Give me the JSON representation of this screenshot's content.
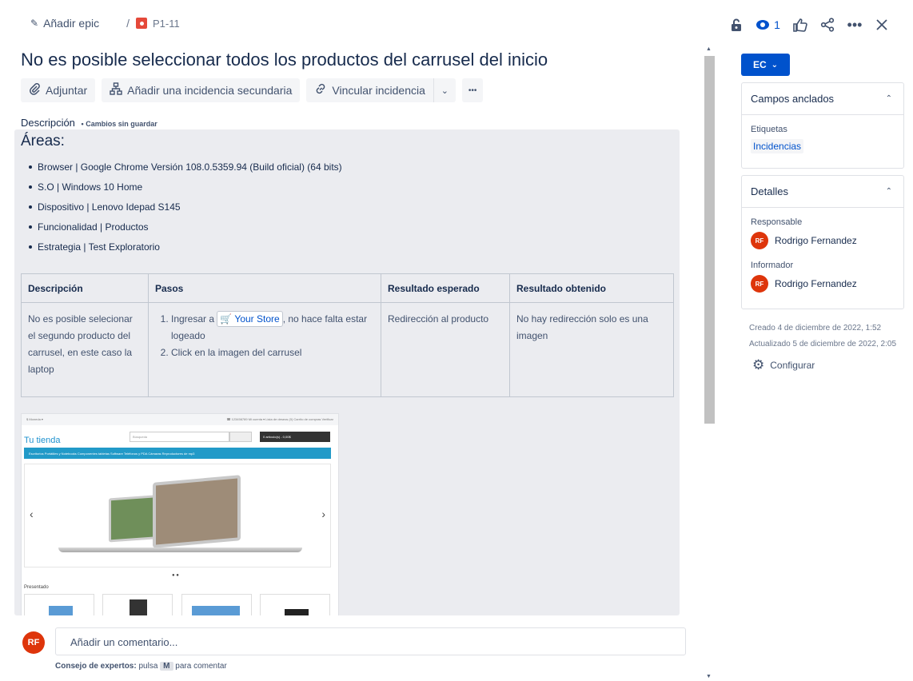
{
  "breadcrumb": {
    "add_epic": "Añadir epic",
    "separator": "/",
    "issue_key": "P1-11"
  },
  "header": {
    "watchers": "1"
  },
  "issue": {
    "title": "No es posible seleccionar todos los productos del carrusel del inicio"
  },
  "actions": {
    "attach": "Adjuntar",
    "child_issue": "Añadir una incidencia secundaria",
    "link_issue": "Vincular incidencia",
    "more": "•••"
  },
  "description": {
    "label": "Descripción",
    "unsaved": "• Cambios sin guardar",
    "heading": "Áreas:",
    "areas": [
      "Browser | Google Chrome Versión 108.0.5359.94 (Build oficial) (64 bits)",
      "S.O | Windows 10 Home",
      "Dispositivo | Lenovo Idepad S145",
      "Funcionalidad | Productos",
      "Estrategia | Test Exploratorio"
    ],
    "table": {
      "headers": [
        "Descripción",
        "Pasos",
        "Resultado esperado",
        "Resultado obtenido"
      ],
      "row": {
        "description": "No es posible selecionar el segundo producto del carrusel, en este caso la laptop",
        "step1_before": "Ingresar a",
        "step1_link": "🛒 Your Store",
        "step1_after": ", no hace falta estar logeado",
        "step2": "Click en la imagen del carrusel",
        "expected": "Redirección al producto",
        "actual": "No hay redirección solo es una imagen"
      }
    },
    "screenshot": {
      "store_name": "Tu tienda",
      "search_placeholder": "Búsqueda",
      "cart": "0 artículo(s) - 0,00$",
      "topbar_left": "$ Moneda ▾",
      "topbar_right": "☎ 123456789   Mi cuenta ▾   Lista de deseos (0)   Carrito de compras   Verificar",
      "menu": "Escritorios    Portátiles y Notebooks    Componentes    tabletas    Software    Teléfonos y PDA    Cámaras    Reproductores de mp3",
      "featured": "Presentado"
    }
  },
  "comment": {
    "avatar": "RF",
    "placeholder": "Añadir un comentario...",
    "tip_bold": "Consejo de expertos:",
    "tip_text": "pulsa",
    "tip_key": "M",
    "tip_after": "para comentar"
  },
  "sidebar": {
    "status": "EC",
    "pinned": {
      "title": "Campos anclados",
      "label_field": "Etiquetas",
      "label_value": "Incidencias"
    },
    "details": {
      "title": "Detalles",
      "assignee_label": "Responsable",
      "assignee": "Rodrigo Fernandez",
      "reporter_label": "Informador",
      "reporter": "Rodrigo Fernandez",
      "avatar": "RF"
    },
    "created": "Creado 4 de diciembre de 2022, 1:52",
    "updated": "Actualizado 5 de diciembre de 2022, 2:05",
    "configure": "Configurar"
  },
  "colors": {
    "primary": "#0052CC",
    "avatar": "#DE350B",
    "bug": "#E5493A"
  }
}
